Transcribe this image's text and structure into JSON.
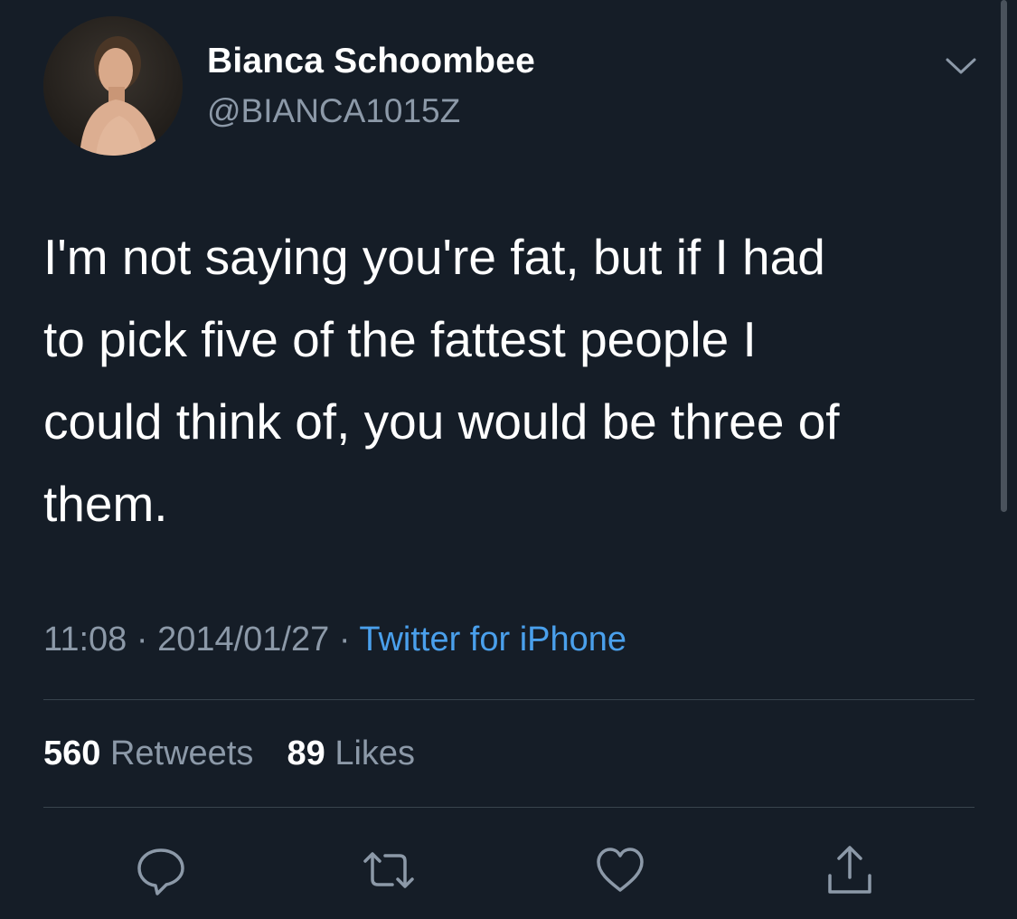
{
  "user": {
    "display_name": "Bianca Schoombee",
    "handle": "@BIANCA1015Z"
  },
  "tweet": {
    "text": "I'm not saying you're fat, but if I had\nto pick five of the fattest people I\ncould think of, you would be three of\nthem.",
    "time": "11:08",
    "date": "2014/01/27",
    "separator": "·",
    "source": "Twitter for iPhone"
  },
  "stats": {
    "retweets_count": "560",
    "retweets_label": "Retweets",
    "likes_count": "89",
    "likes_label": "Likes"
  },
  "colors": {
    "background": "#151d27",
    "text_primary": "#ffffff",
    "text_secondary": "#8c99a8",
    "link": "#4aa0ec",
    "divider": "#38444d"
  },
  "icons": {
    "caret": "chevron-down-icon",
    "reply": "reply-icon",
    "retweet": "retweet-icon",
    "like": "heart-icon",
    "share": "share-icon"
  }
}
